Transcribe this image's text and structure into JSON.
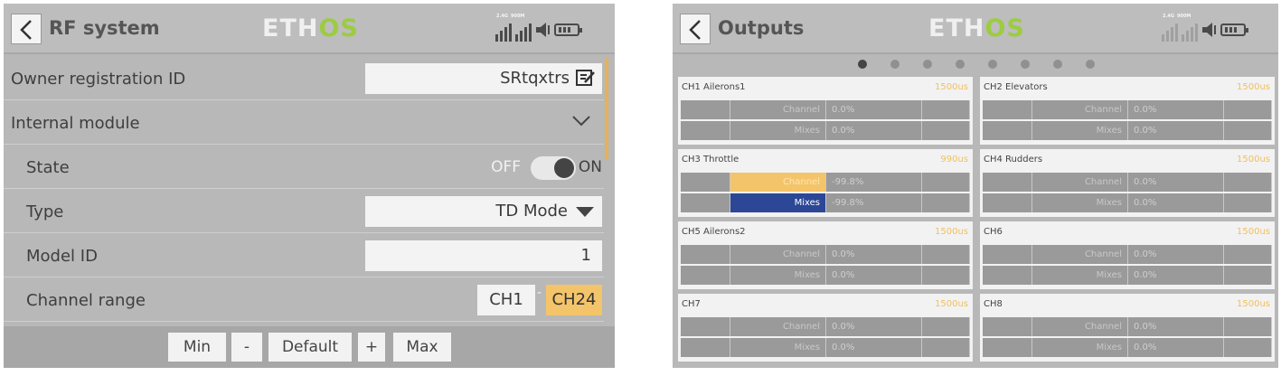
{
  "left": {
    "header": {
      "title": "RF system",
      "logo_main": "ETH",
      "logo_accent": "OS",
      "signal_label_a": "2.4G",
      "signal_label_b": "900M"
    },
    "rows": {
      "owner": {
        "label": "Owner registration ID",
        "value": "SRtqxtrs"
      },
      "internal": {
        "label": "Internal module"
      },
      "state": {
        "label": "State",
        "off": "OFF",
        "on": "ON",
        "enabled": true
      },
      "type": {
        "label": "Type",
        "value": "TD Mode"
      },
      "model_id": {
        "label": "Model ID",
        "value": "1"
      },
      "channel_range": {
        "label": "Channel range",
        "from": "CH1",
        "separator": "-",
        "to": "CH24"
      }
    },
    "bottom": {
      "min": "Min",
      "minus": "-",
      "default": "Default",
      "plus": "+",
      "max": "Max"
    }
  },
  "right": {
    "header": {
      "title": "Outputs",
      "logo_main": "ETH",
      "logo_accent": "OS",
      "signal_label_a": "2.4G",
      "signal_label_b": "900M"
    },
    "pager": {
      "pages": 8,
      "active": 1
    },
    "channels": [
      {
        "head": "CH1  Ailerons1",
        "us": "1500us",
        "channel_label": "Channel",
        "channel_value": "0.0%",
        "mixes_label": "Mixes",
        "mixes_value": "0.0%",
        "highlight": false
      },
      {
        "head": "CH2  Elevators",
        "us": "1500us",
        "channel_label": "Channel",
        "channel_value": "0.0%",
        "mixes_label": "Mixes",
        "mixes_value": "0.0%",
        "highlight": false
      },
      {
        "head": "CH3  Throttle",
        "us": "990us",
        "channel_label": "Channel",
        "channel_value": "-99.8%",
        "mixes_label": "Mixes",
        "mixes_value": "-99.8%",
        "highlight": true
      },
      {
        "head": "CH4  Rudders",
        "us": "1500us",
        "channel_label": "Channel",
        "channel_value": "0.0%",
        "mixes_label": "Mixes",
        "mixes_value": "0.0%",
        "highlight": false
      },
      {
        "head": "CH5  Ailerons2",
        "us": "1500us",
        "channel_label": "Channel",
        "channel_value": "0.0%",
        "mixes_label": "Mixes",
        "mixes_value": "0.0%",
        "highlight": false
      },
      {
        "head": "CH6",
        "us": "1500us",
        "channel_label": "Channel",
        "channel_value": "0.0%",
        "mixes_label": "Mixes",
        "mixes_value": "0.0%",
        "highlight": false
      },
      {
        "head": "CH7",
        "us": "1500us",
        "channel_label": "Channel",
        "channel_value": "0.0%",
        "mixes_label": "Mixes",
        "mixes_value": "0.0%",
        "highlight": false
      },
      {
        "head": "CH8",
        "us": "1500us",
        "channel_label": "Channel",
        "channel_value": "0.0%",
        "mixes_label": "Mixes",
        "mixes_value": "0.0%",
        "highlight": false
      }
    ]
  },
  "colors": {
    "accent": "#f4c46a",
    "mixes_active": "#2c4796",
    "logo_os": "#9ccc40"
  }
}
